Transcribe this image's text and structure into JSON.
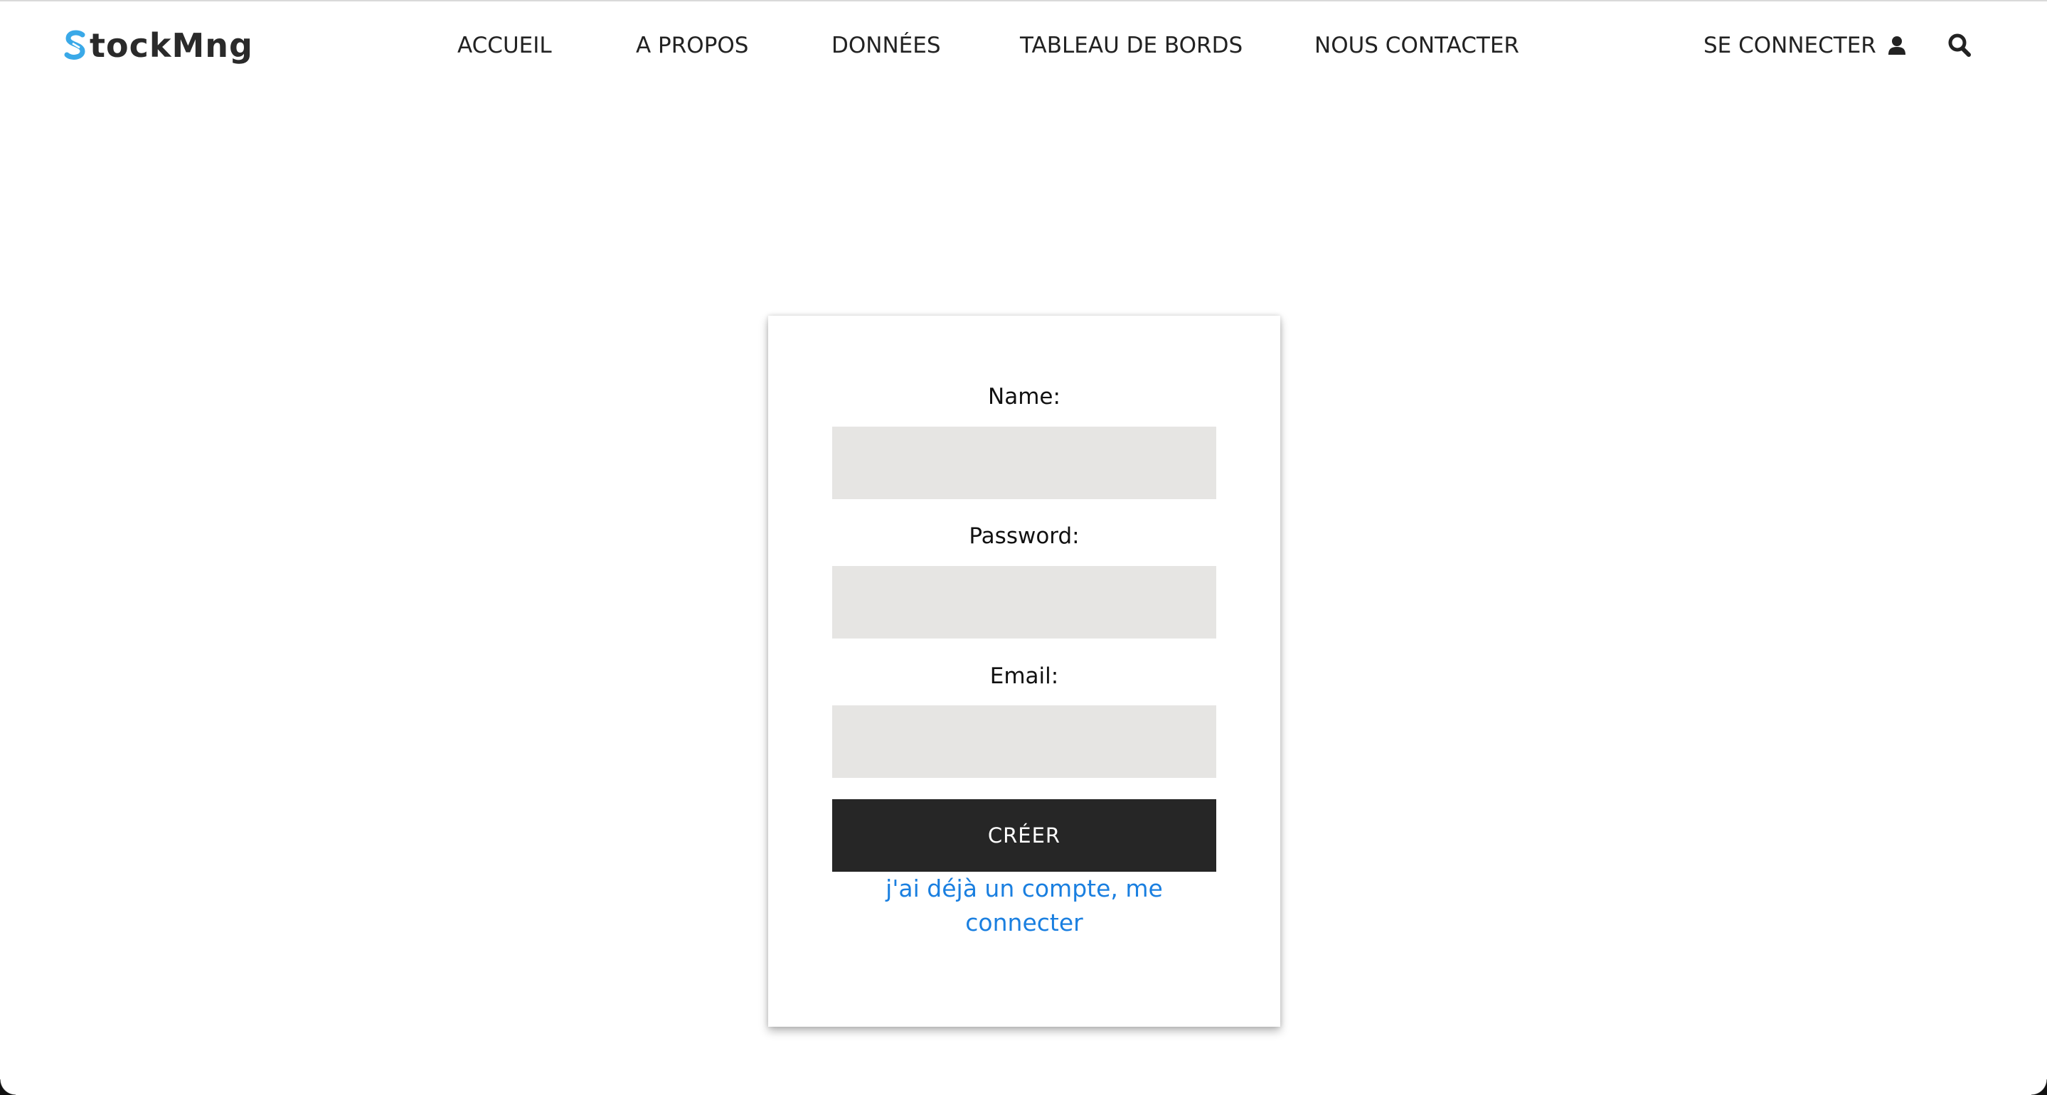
{
  "header": {
    "logo_text": "tockMng",
    "logo_initial": "S",
    "nav": [
      {
        "label": "ACCUEIL"
      },
      {
        "label": "A PROPOS"
      },
      {
        "label": "DONNÉES"
      },
      {
        "label": "TABLEAU DE BORDS"
      },
      {
        "label": "NOUS CONTACTER"
      }
    ],
    "login_label": "SE CONNECTER",
    "user_icon": "user-icon",
    "search_icon": "search-icon"
  },
  "form": {
    "name_label": "Name:",
    "name_value": "",
    "password_label": "Password:",
    "password_value": "",
    "email_label": "Email:",
    "email_value": "",
    "submit_label": "CRÉER",
    "signin_link": "j'ai déjà un compte, me connecter"
  },
  "colors": {
    "accent_link": "#1a7fe0",
    "logo_accent": "#3aa9e8",
    "button_bg": "#262626",
    "input_bg": "#e6e5e3"
  }
}
